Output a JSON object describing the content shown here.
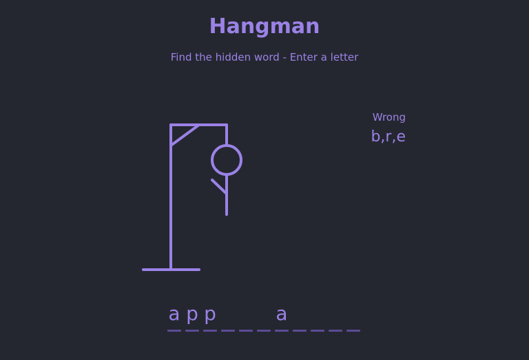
{
  "title": "Hangman",
  "subtitle": "Find the hidden word - Enter a letter",
  "wrong": {
    "label": "Wrong",
    "letters": "b,r,e"
  },
  "word": {
    "slots": [
      "a",
      "p",
      "p",
      "",
      "",
      "",
      "a",
      "",
      "",
      "",
      ""
    ]
  },
  "hangman_parts_shown": [
    "base",
    "pole",
    "top-beam",
    "brace",
    "rope-head",
    "body",
    "left-arm"
  ],
  "colors": {
    "background": "#242730",
    "accent": "#9b82e6",
    "underline": "#5b4b95"
  }
}
